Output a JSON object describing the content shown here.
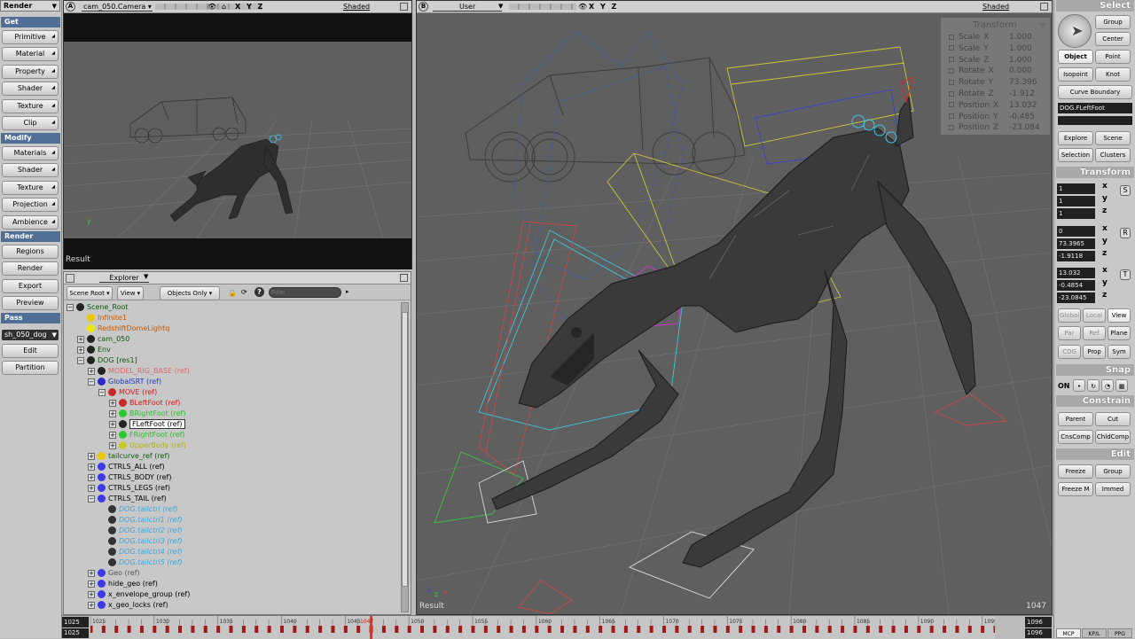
{
  "left_toolbar": {
    "top_menu": "Render",
    "sections": [
      {
        "header": "Get",
        "items": [
          "Primitive",
          "Material",
          "Property",
          "Shader",
          "Texture",
          "Clip"
        ]
      },
      {
        "header": "Modify",
        "items": [
          "Materials",
          "Shader",
          "Texture",
          "Projection",
          "Ambience"
        ]
      },
      {
        "header": "Render",
        "items": [
          "Regions",
          "Render",
          "Export",
          "Preview"
        ]
      },
      {
        "header": "Pass",
        "items": [
          "Edit",
          "Partition"
        ]
      }
    ],
    "pass_select": "sh_050_dog"
  },
  "viewport_a": {
    "letter": "A",
    "camera": "cam_050.Camera",
    "axes": "X Y Z",
    "mode": "Shaded",
    "label": "Result"
  },
  "viewport_b": {
    "letter": "B",
    "camera": "User",
    "axes": "X Y Z",
    "mode": "Shaded",
    "label": "Result",
    "frame": "1047"
  },
  "transform_overlay": {
    "title": "Transform",
    "rows": [
      {
        "label": "Scale",
        "axis": "X",
        "value": "1.000"
      },
      {
        "label": "Scale",
        "axis": "Y",
        "value": "1.000"
      },
      {
        "label": "Scale",
        "axis": "Z",
        "value": "1.000"
      },
      {
        "label": "Rotate",
        "axis": "X",
        "value": "0.000"
      },
      {
        "label": "Rotate",
        "axis": "Y",
        "value": "73.396"
      },
      {
        "label": "Rotate",
        "axis": "Z",
        "value": "-1.912"
      },
      {
        "label": "Position",
        "axis": "X",
        "value": "13.032"
      },
      {
        "label": "Position",
        "axis": "Y",
        "value": "-0.485"
      },
      {
        "label": "Position",
        "axis": "Z",
        "value": "-23.084"
      }
    ]
  },
  "explorer": {
    "title": "Explorer",
    "scope": "Scene Root",
    "view": "View",
    "filter_mode": "Objects Only",
    "filter_placeholder": "Filter",
    "nodes": [
      {
        "text": "Scene_Root",
        "color": "#0a5a0a"
      },
      {
        "text": "Infinite1",
        "color": "#c85a00"
      },
      {
        "text": "RedshiftDomeLightq",
        "color": "#c85a00"
      },
      {
        "text": "cam_050",
        "color": "#0a5a0a"
      },
      {
        "text": "Env",
        "color": "#0a5a0a"
      },
      {
        "text": "DOG [res1]",
        "color": "#0a5a0a"
      },
      {
        "text": "MODEL_RIG_BASE (ref)",
        "color": "#d86a6a"
      },
      {
        "text": "GlobalSRT (ref)",
        "color": "#1f36c8"
      },
      {
        "text": "MOVE (ref)",
        "color": "#d81818"
      },
      {
        "text": "BLeftFoot (ref)",
        "color": "#d81818"
      },
      {
        "text": "BRightFoot (ref)",
        "color": "#28c028"
      },
      {
        "text": "FLeftFoot (ref)",
        "color": "#000000"
      },
      {
        "text": "FRightFoot (ref)",
        "color": "#28c028"
      },
      {
        "text": "UpperBody (ref)",
        "color": "#b0b000"
      },
      {
        "text": "tailcurve_ref (ref)",
        "color": "#0a5a0a"
      },
      {
        "text": "CTRLS_ALL (ref)",
        "color": "#000000"
      },
      {
        "text": "CTRLS_BODY (ref)",
        "color": "#000000"
      },
      {
        "text": "CTRLS_LEGS (ref)",
        "color": "#000000"
      },
      {
        "text": "CTRLS_TAIL (ref)",
        "color": "#000000"
      },
      {
        "text": "DOG.tailctrl (ref)",
        "color": "#38a8e0"
      },
      {
        "text": "DOG.tailctrl1 (ref)",
        "color": "#38a8e0"
      },
      {
        "text": "DOG.tailctrl2 (ref)",
        "color": "#38a8e0"
      },
      {
        "text": "DOG.tailctrl3 (ref)",
        "color": "#38a8e0"
      },
      {
        "text": "DOG.tailctrl4 (ref)",
        "color": "#38a8e0"
      },
      {
        "text": "DOG.tailctrl5 (ref)",
        "color": "#38a8e0"
      },
      {
        "text": "Geo (ref)",
        "color": "#555555"
      },
      {
        "text": "hide_geo (ref)",
        "color": "#000000"
      },
      {
        "text": "x_envelope_group (ref)",
        "color": "#000000"
      },
      {
        "text": "x_geo_locks (ref)",
        "color": "#000000"
      }
    ]
  },
  "right_panel": {
    "select_header": "Select",
    "group": "Group",
    "center": "Center",
    "object": "Object",
    "point": "Point",
    "isopoint": "Isopoint",
    "knot": "Knot",
    "curve_boundary": "Curve Boundary",
    "selection_name": "DOG.FLeftFoot",
    "explore": "Explore",
    "scene": "Scene",
    "selection": "Selection",
    "clusters": "Clusters",
    "transform_header": "Transform",
    "scale": [
      "1",
      "1",
      "1"
    ],
    "rotate": [
      "0",
      "73.3965",
      "-1.9118"
    ],
    "translate": [
      "13.032",
      "-0.4854",
      "-23.0845"
    ],
    "axes": [
      "x",
      "y",
      "z"
    ],
    "global": "Global",
    "local": "Local",
    "view": "View",
    "par": "Par",
    "ref": "Ref",
    "plane": "Plane",
    "cog": "COG",
    "prop": "Prop",
    "sym": "Sym",
    "snap_header": "Snap",
    "snap_on": "ON",
    "constrain_header": "Constrain",
    "parent": "Parent",
    "cut": "Cut",
    "cnscomp": "CnsComp",
    "childcomp": "ChldComp",
    "edit_header": "Edit",
    "freeze": "Freeze",
    "edit_group": "Group",
    "freeze_m": "Freeze M",
    "immed": "Immed",
    "tabs": [
      "MCP",
      "KP/L",
      "PPG"
    ]
  },
  "timeline": {
    "start": "1025",
    "start2": "1025",
    "end": "1096",
    "end2": "1096",
    "current": "1047",
    "ticks": [
      "1025",
      "1030",
      "1035",
      "1040",
      "1045",
      "1050",
      "1055",
      "1060",
      "1065",
      "1070",
      "1075",
      "1080",
      "1085",
      "1090",
      "1095"
    ]
  }
}
